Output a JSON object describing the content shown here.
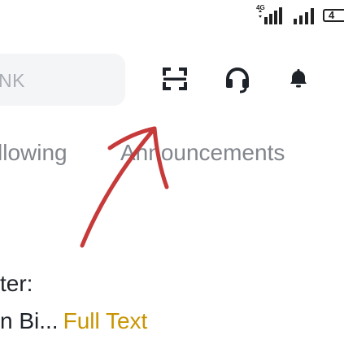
{
  "status_bar": {
    "network_label": "4G",
    "battery_level": "4"
  },
  "header": {
    "search_text": "NK",
    "icons": [
      "scan-icon",
      "headset-icon",
      "bell-icon"
    ]
  },
  "tabs": [
    {
      "label": "llowing"
    },
    {
      "label": "Announcements"
    }
  ],
  "post": {
    "line1": "ter:",
    "line2": "n Bi...",
    "full_text_link": "Full Text"
  },
  "colors": {
    "accent": "#c99400",
    "tab_text": "#81858c",
    "body_text": "#1e2329",
    "search_bg": "#f4f5f7",
    "annotation": "#c73a3a"
  }
}
